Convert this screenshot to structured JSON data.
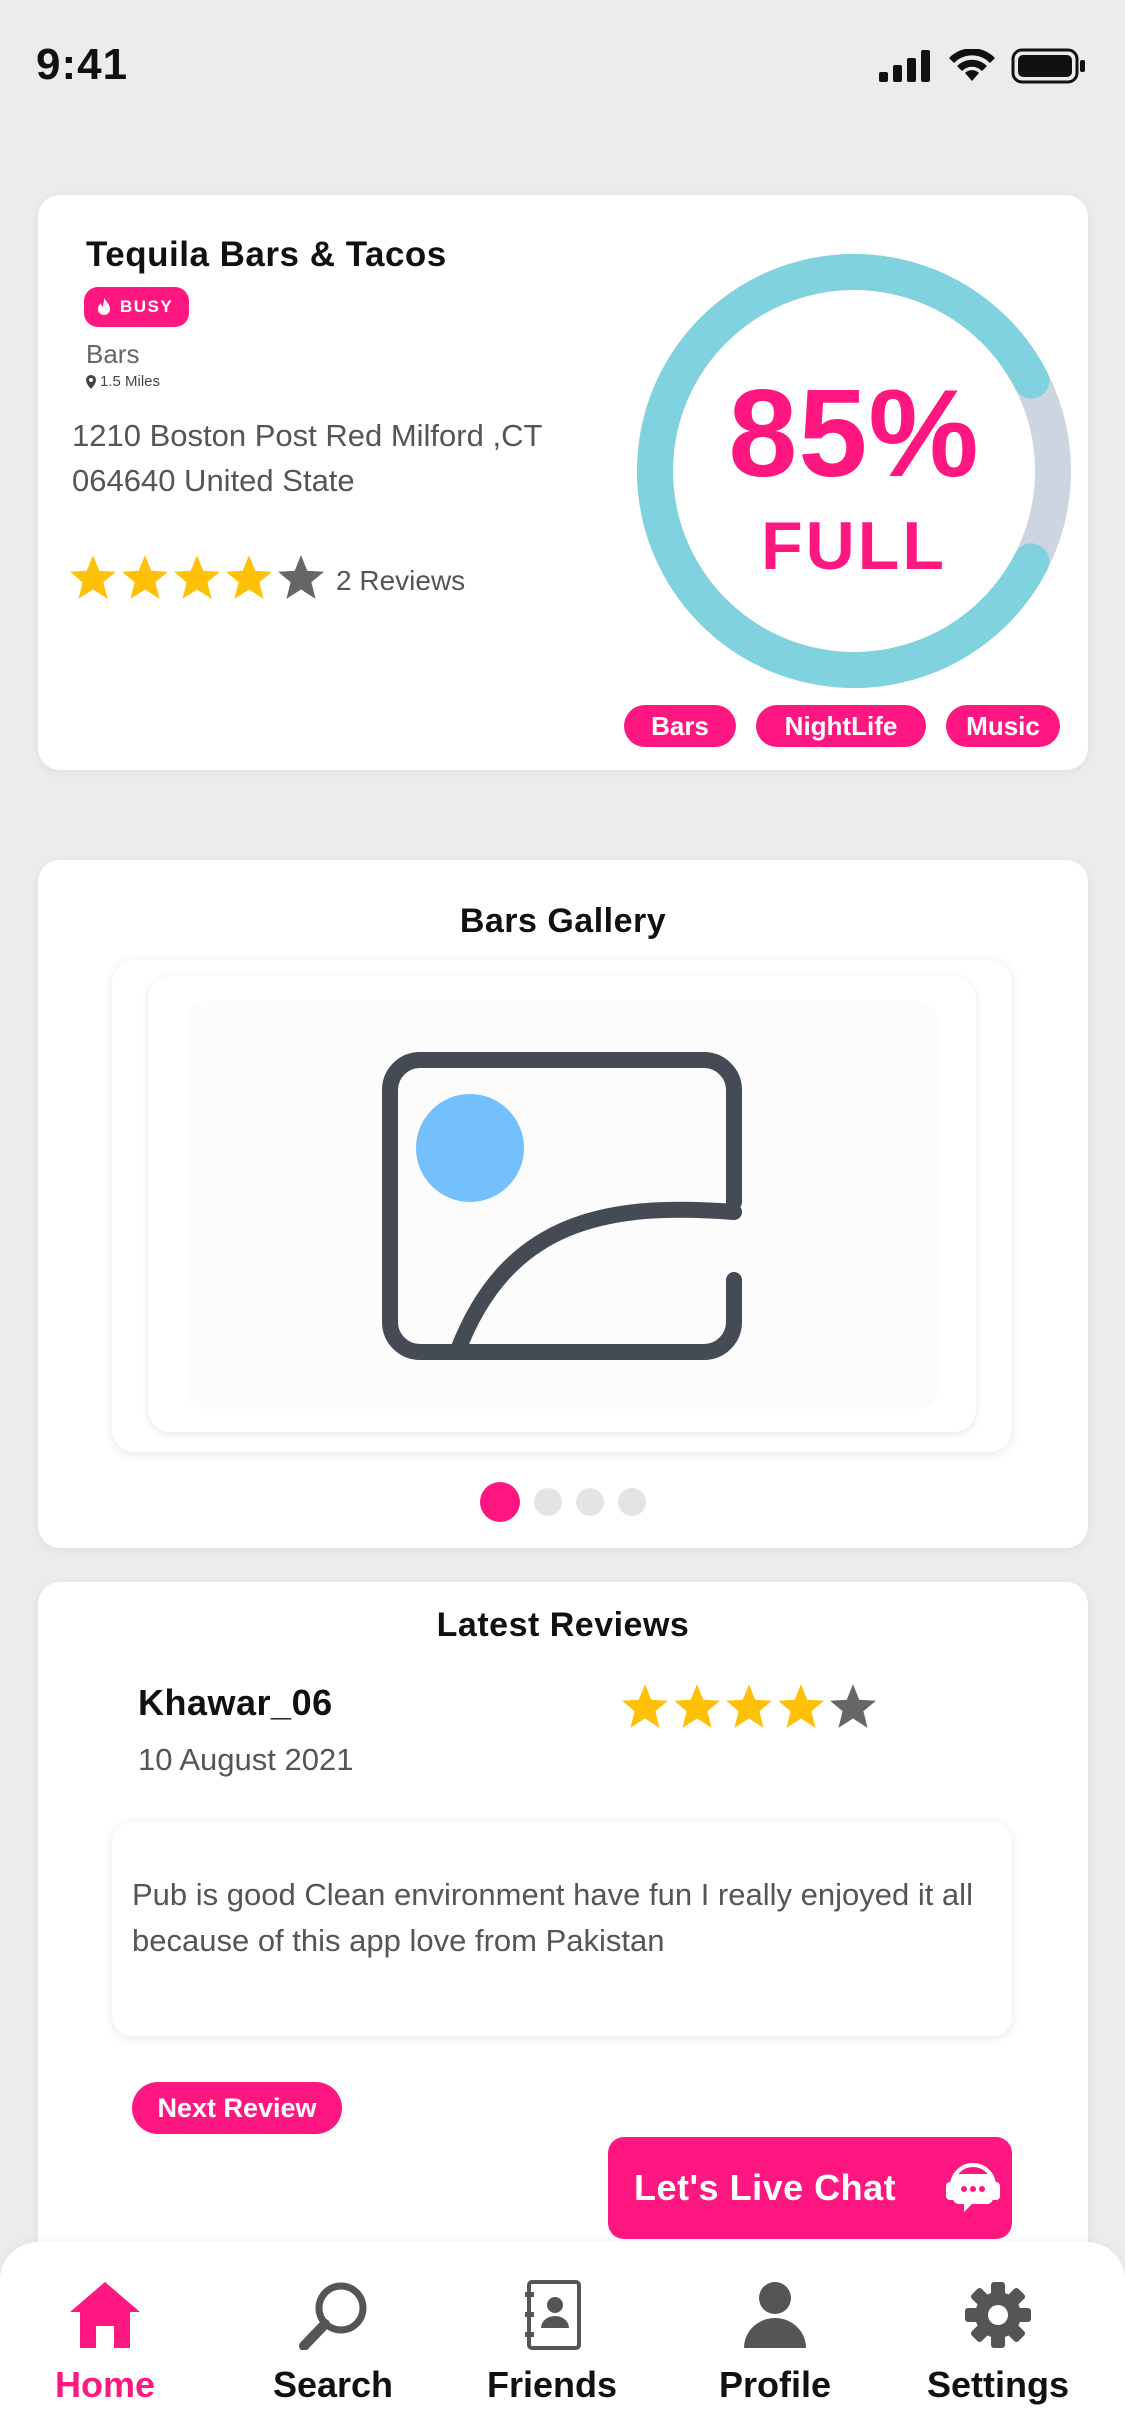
{
  "status_bar": {
    "time": "9:41"
  },
  "venue": {
    "name": "Tequila Bars & Tacos",
    "busy_label": "BUSY",
    "category": "Bars",
    "distance": "1.5 Miles",
    "address": "1210 Boston Post Red Milford ,CT 064640 United State",
    "rating": 4,
    "rating_max": 5,
    "reviews_count": "2 Reviews",
    "capacity": {
      "percent_text": "85%",
      "label": "FULL",
      "value": 0.85
    },
    "tags": [
      "Bars",
      "NightLife",
      "Music"
    ]
  },
  "gallery": {
    "title": "Bars Gallery",
    "image_icon": "image-placeholder-icon",
    "page_count": 4,
    "active_page": 1
  },
  "reviews": {
    "title": "Latest Reviews",
    "current": {
      "author": "Khawar_06",
      "date": "10 August 2021",
      "rating": 4,
      "text": "Pub is good Clean environment have fun I really enjoyed it all because of this app love from Pakistan"
    },
    "next_label": "Next Review",
    "chat_label": "Let's Live Chat",
    "chat_icon": "chat-support-icon"
  },
  "nav": {
    "items": [
      {
        "label": "Home",
        "icon": "home-icon",
        "active": true
      },
      {
        "label": "Search",
        "icon": "search-icon",
        "active": false
      },
      {
        "label": "Friends",
        "icon": "contacts-icon",
        "active": false
      },
      {
        "label": "Profile",
        "icon": "user-icon",
        "active": false
      },
      {
        "label": "Settings",
        "icon": "gear-icon",
        "active": false
      }
    ]
  },
  "colors": {
    "accent": "#ff1781",
    "gauge_fill": "#7fd2de",
    "gauge_track": "#cdd5e0",
    "star": "#ffc107",
    "star_empty": "#666666",
    "icon_dark": "#555555"
  }
}
